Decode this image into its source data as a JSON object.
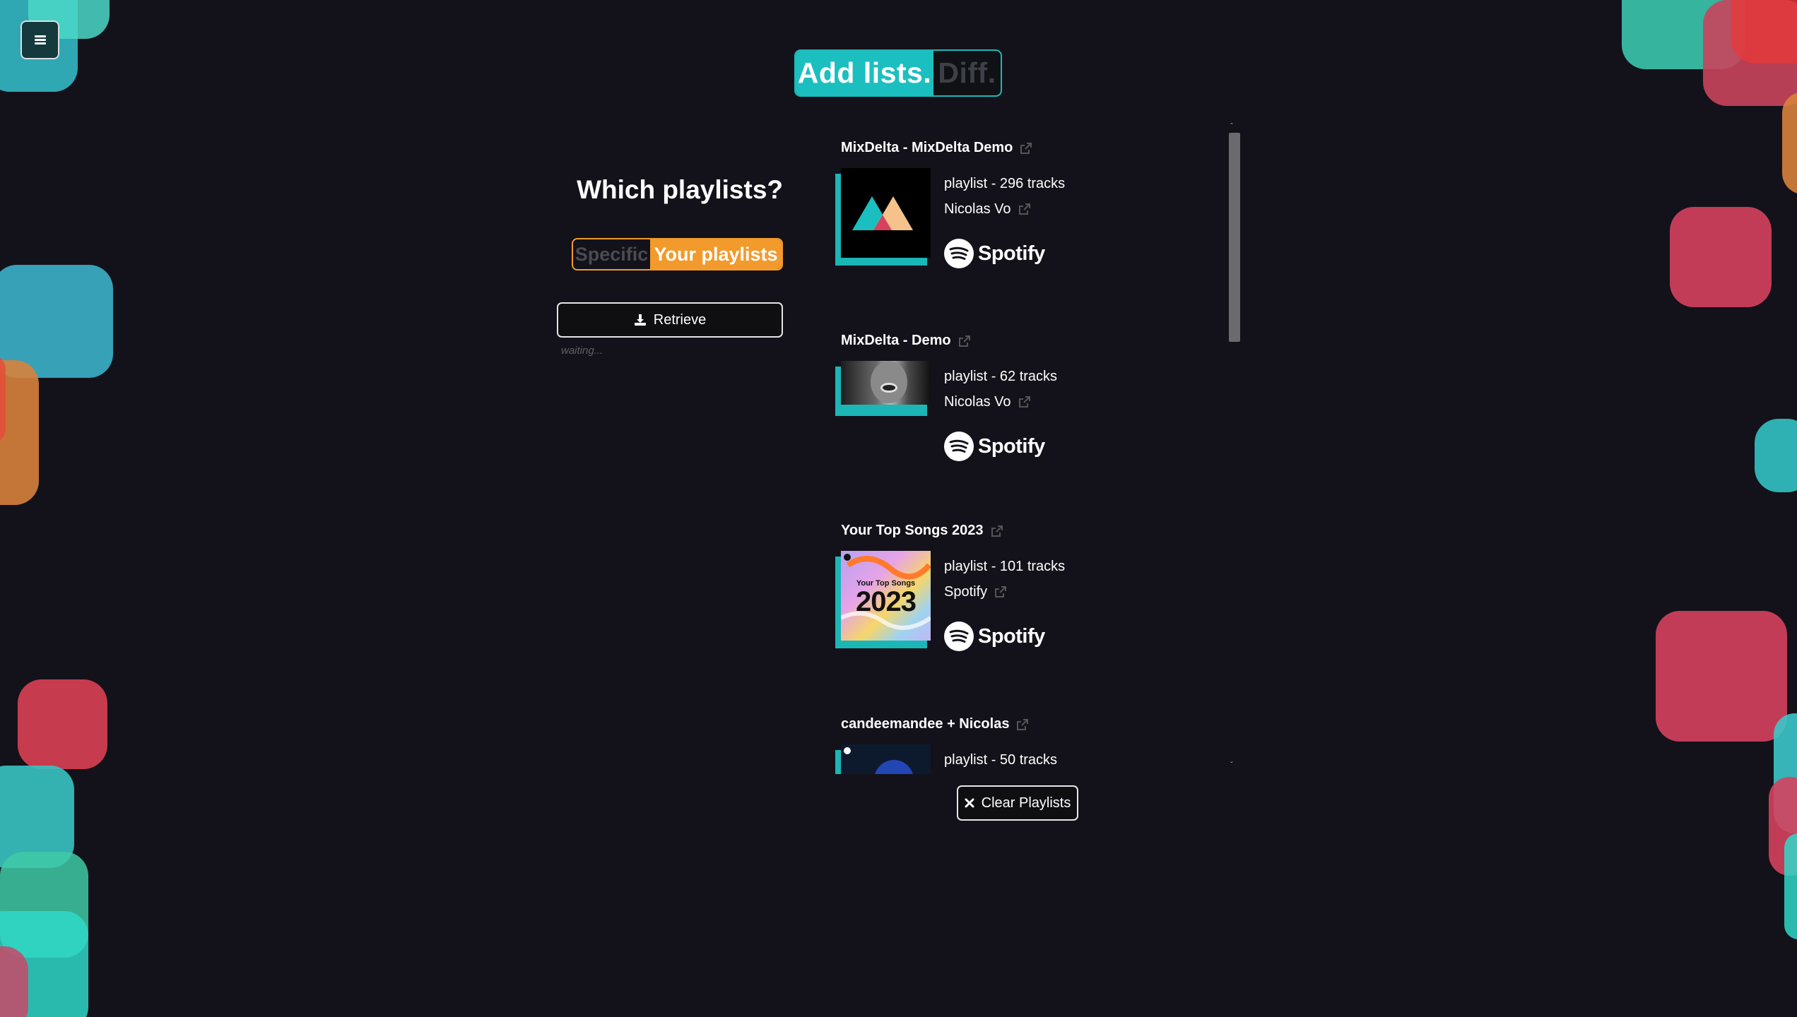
{
  "header": {
    "menu_icon": "hamburger-icon",
    "mode_active": "Add lists.",
    "mode_inactive": "Diff."
  },
  "left_panel": {
    "question": "Which playlists?",
    "source_inactive": "Specific",
    "source_active": "Your playlists",
    "retrieve_label": "Retrieve",
    "retrieve_icon": "download-icon",
    "status": "waiting..."
  },
  "playlists": [
    {
      "title": "MixDelta - MixDelta Demo",
      "meta": "playlist - 296 tracks",
      "owner": "Nicolas Vo",
      "platform": "Spotify"
    },
    {
      "title": "MixDelta - Demo",
      "meta": "playlist - 62 tracks",
      "owner": "Nicolas Vo",
      "platform": "Spotify"
    },
    {
      "title": "Your Top Songs 2023",
      "meta": "playlist - 101 tracks",
      "owner": "Spotify",
      "platform": "Spotify",
      "cover_text": "Your Top Songs",
      "cover_year": "2023"
    },
    {
      "title": "candeemandee + Nicolas",
      "meta": "playlist - 50 tracks"
    }
  ],
  "footer": {
    "clear_label": "Clear Playlists",
    "clear_icon": "close-icon"
  },
  "colors": {
    "background": "#13121a",
    "accent_teal": "#1cbfbf",
    "accent_orange": "#f29a2c",
    "blob_red": "#d6415f",
    "blob_teal": "#2ec4c4"
  }
}
